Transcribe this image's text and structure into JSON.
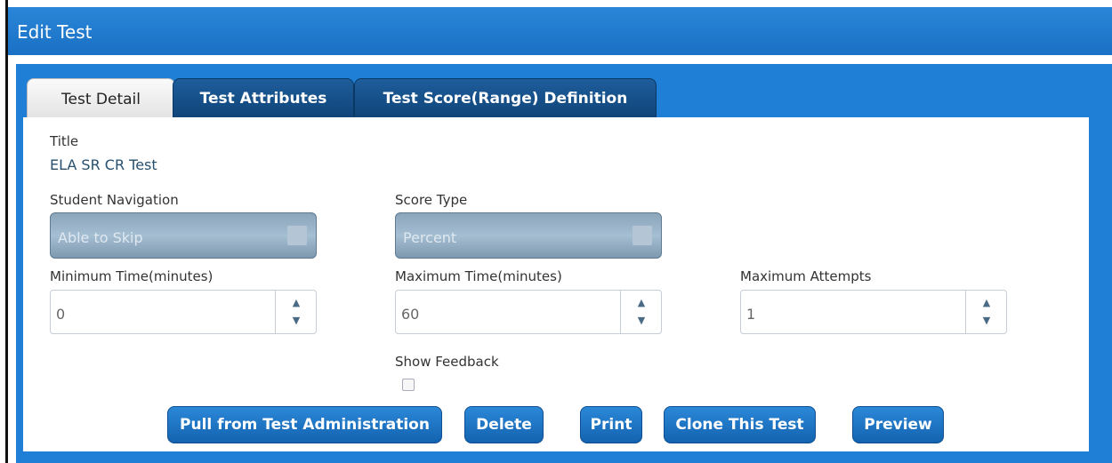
{
  "window": {
    "title": "Edit Test"
  },
  "tabs": [
    {
      "label": "Test Detail",
      "active": true
    },
    {
      "label": "Test Attributes",
      "active": false
    },
    {
      "label": "Test Score(Range) Definition",
      "active": false
    }
  ],
  "form": {
    "title_label": "Title",
    "title_value": "ELA SR CR Test",
    "student_navigation": {
      "label": "Student Navigation",
      "value": "Able to Skip"
    },
    "score_type": {
      "label": "Score Type",
      "value": "Percent"
    },
    "minimum_time": {
      "label": "Minimum Time(minutes)",
      "value": "0"
    },
    "maximum_time": {
      "label": "Maximum Time(minutes)",
      "value": "60"
    },
    "maximum_attempts": {
      "label": "Maximum Attempts",
      "value": "1"
    },
    "show_feedback": {
      "label": "Show Feedback",
      "checked": false
    }
  },
  "buttons": {
    "pull": "Pull from Test Administration",
    "delete": "Delete",
    "print": "Print",
    "clone": "Clone This Test",
    "preview": "Preview"
  },
  "spinner_glyphs": {
    "up": "▲",
    "down": "▼"
  },
  "colors": {
    "header": "#1f7fd6",
    "tab_inactive": "#0f4478",
    "button": "#1a6fc0"
  }
}
